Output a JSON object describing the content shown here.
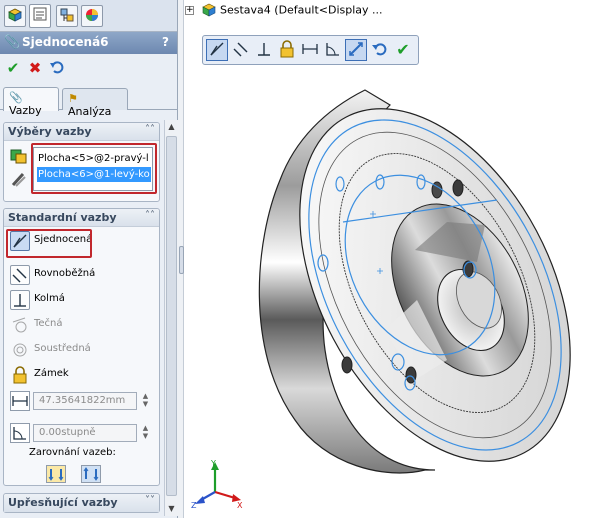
{
  "pm": {
    "title": "Sjednocená6",
    "help": "?",
    "tabs": [
      {
        "name": "feature-manager-icon",
        "glyph": "▣"
      },
      {
        "name": "property-manager-icon",
        "glyph": "☰"
      },
      {
        "name": "configuration-manager-icon",
        "glyph": "▦"
      },
      {
        "name": "display-manager-icon",
        "glyph": "◐"
      }
    ],
    "subtabs": {
      "mates": "Vazby",
      "analysis": "Analýza"
    },
    "selections": {
      "header": "Výběry vazby",
      "items": [
        "Plocha<5>@2-pravý-l",
        "Plocha<6>@1-levý-ko"
      ]
    },
    "standard": {
      "header": "Standardní vazby",
      "coincident": "Sjednocená",
      "parallel": "Rovnoběžná",
      "perpendicular": "Kolmá",
      "tangent": "Tečná",
      "concentric": "Soustředná",
      "lock": "Zámek",
      "distance_value": "47.35641822mm",
      "angle_value": "0.00stupně",
      "alignment_label": "Zarovnání vazeb:"
    },
    "advanced": {
      "header": "Upřesňující vazby"
    }
  },
  "graphics": {
    "tree_label": "Sestava4  (Default<Display ...",
    "triad": {
      "x": "X",
      "y": "Y",
      "z": "Z"
    }
  },
  "colors": {
    "accept": "#1e9e2a",
    "cancel": "#d11a1a",
    "highlight": "#c1272d",
    "selection": "#3399ff",
    "edge_highlight": "#3c8fe0"
  }
}
